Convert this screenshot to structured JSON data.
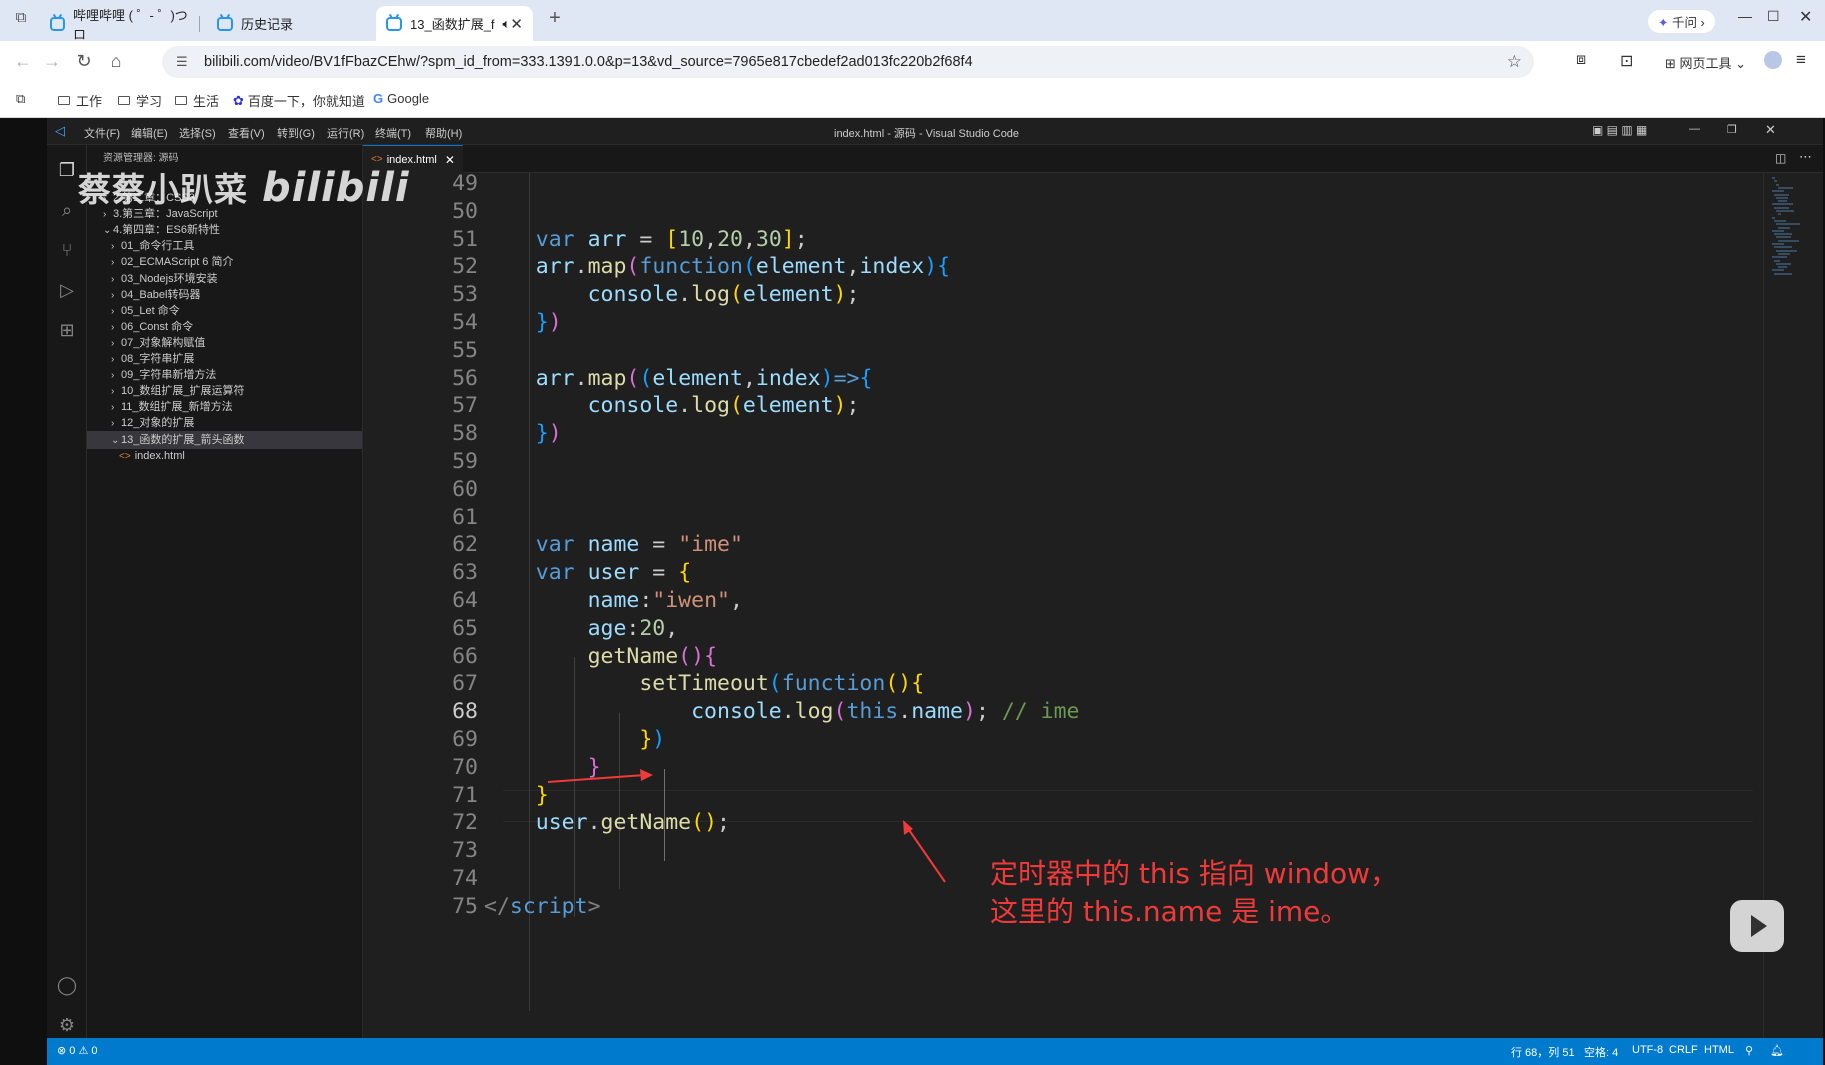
{
  "browser": {
    "tabs": [
      {
        "label": "哔哩哔哩 ( ゜- ゜)つロ"
      },
      {
        "label": "历史记录"
      },
      {
        "label": "13_函数扩展_f"
      }
    ],
    "new_tab": "+",
    "qianwen": "千问",
    "url": "bilibili.com/video/BV1fFbazCEhw/?spm_id_from=333.1391.0.0&p=13&vd_source=7965e817cbedef2ad013fc220b2f68f4",
    "tools_label": "网页工具",
    "bookmarks": [
      "工作",
      "学习",
      "生活",
      "百度一下，你就知道",
      "Google"
    ]
  },
  "vscode": {
    "menu": [
      "文件(F)",
      "编辑(E)",
      "选择(S)",
      "查看(V)",
      "转到(G)",
      "运行(R)",
      "终端(T)",
      "帮助(H)"
    ],
    "window_title": "index.html - 源码 - Visual Studio Code",
    "explorer_title": "资源管理器: 源码",
    "tree": [
      {
        "label": "2.第二章：CSS3",
        "indent": 1,
        "chev": "›"
      },
      {
        "label": "3.第三章：JavaScript",
        "indent": 1,
        "chev": "›"
      },
      {
        "label": "4.第四章：ES6新特性",
        "indent": 1,
        "chev": "⌄"
      },
      {
        "label": "01_命令行工具",
        "indent": 2,
        "chev": "›"
      },
      {
        "label": "02_ECMAScript 6 简介",
        "indent": 2,
        "chev": "›"
      },
      {
        "label": "03_Nodejs环境安装",
        "indent": 2,
        "chev": "›"
      },
      {
        "label": "04_Babel转码器",
        "indent": 2,
        "chev": "›"
      },
      {
        "label": "05_Let 命令",
        "indent": 2,
        "chev": "›"
      },
      {
        "label": "06_Const 命令",
        "indent": 2,
        "chev": "›"
      },
      {
        "label": "07_对象解构赋值",
        "indent": 2,
        "chev": "›"
      },
      {
        "label": "08_字符串扩展",
        "indent": 2,
        "chev": "›"
      },
      {
        "label": "09_字符串新增方法",
        "indent": 2,
        "chev": "›"
      },
      {
        "label": "10_数组扩展_扩展运算符",
        "indent": 2,
        "chev": "›"
      },
      {
        "label": "11_数组扩展_新增方法",
        "indent": 2,
        "chev": "›"
      },
      {
        "label": "12_对象的扩展",
        "indent": 2,
        "chev": "›"
      },
      {
        "label": "13_函数的扩展_箭头函数",
        "indent": 2,
        "chev": "⌄",
        "selected": true
      },
      {
        "label": "index.html",
        "indent": 3,
        "chev": "",
        "file": true
      }
    ],
    "editor_tab": "index.html",
    "status": {
      "errors": "⊗ 0 ⚠ 0",
      "position": "行 68，列 51",
      "spaces": "空格: 4",
      "encoding": "UTF-8",
      "eol": "CRLF",
      "language": "HTML"
    }
  },
  "code_lines": [
    {
      "n": "49",
      "html": ""
    },
    {
      "n": "50",
      "html": ""
    },
    {
      "n": "51",
      "html": "    <span class='kw'>var</span> <span class='var'>arr</span> = <span class='b1'>[</span><span class='num'>10</span>,<span class='num'>20</span>,<span class='num'>30</span><span class='b1'>]</span>;"
    },
    {
      "n": "52",
      "html": "    <span class='var'>arr</span>.<span class='fn'>map</span><span class='b2'>(</span><span class='kw'>function</span><span class='b3'>(</span><span class='var'>element</span>,<span class='var'>index</span><span class='b3'>){</span>"
    },
    {
      "n": "53",
      "html": "        <span class='var'>console</span>.<span class='fn'>log</span><span class='b1'>(</span><span class='var'>element</span><span class='b1'>)</span>;"
    },
    {
      "n": "54",
      "html": "    <span class='b3'>}</span><span class='b2'>)</span>"
    },
    {
      "n": "55",
      "html": ""
    },
    {
      "n": "56",
      "html": "    <span class='var'>arr</span>.<span class='fn'>map</span><span class='b2'>(</span><span class='b3'>(</span><span class='var'>element</span>,<span class='var'>index</span><span class='b3'>)</span><span class='kw'>=&gt;</span><span class='b3'>{</span>"
    },
    {
      "n": "57",
      "html": "        <span class='var'>console</span>.<span class='fn'>log</span><span class='b1'>(</span><span class='var'>element</span><span class='b1'>)</span>;"
    },
    {
      "n": "58",
      "html": "    <span class='b3'>}</span><span class='b2'>)</span>"
    },
    {
      "n": "59",
      "html": ""
    },
    {
      "n": "60",
      "html": ""
    },
    {
      "n": "61",
      "html": ""
    },
    {
      "n": "62",
      "html": "    <span class='kw'>var</span> <span class='var'>name</span> = <span class='str'>\"ime\"</span>"
    },
    {
      "n": "63",
      "html": "    <span class='kw'>var</span> <span class='var'>user</span> = <span class='b1'>{</span>"
    },
    {
      "n": "64",
      "html": "        <span class='var'>name</span>:<span class='str'>\"iwen\"</span>,"
    },
    {
      "n": "65",
      "html": "        <span class='var'>age</span>:<span class='num'>20</span>,"
    },
    {
      "n": "66",
      "html": "        <span class='fn'>getName</span><span class='b2'>()</span><span class='b2'>{</span>"
    },
    {
      "n": "67",
      "html": "            <span class='fn'>setTimeout</span><span class='b3'>(</span><span class='kw'>function</span><span class='b1'>()</span><span class='b1'>{</span>"
    },
    {
      "n": "68",
      "html": "                <span class='var'>console</span>.<span class='fn'>log</span><span class='b2'>(</span><span class='kw'>this</span>.<span class='var'>name</span><span class='b2'>)</span>; <span class='cm'>// ime</span>"
    },
    {
      "n": "69",
      "html": "            <span class='b1'>}</span><span class='b3'>)</span>"
    },
    {
      "n": "70",
      "html": "        <span class='b2'>}</span>"
    },
    {
      "n": "71",
      "html": "    <span class='b1'>}</span>"
    },
    {
      "n": "72",
      "html": "    <span class='var'>user</span>.<span class='fn'>getName</span><span class='b1'>()</span>;"
    },
    {
      "n": "73",
      "html": ""
    },
    {
      "n": "74",
      "html": ""
    },
    {
      "n": "75",
      "html": "<span class='tag'>&lt;/</span><span class='tagn'>script</span><span class='tag'>&gt;</span>"
    }
  ],
  "annotation": {
    "line1": "定时器中的 this 指向 window，",
    "line2": "这里的 this.name 是 ime。"
  },
  "watermark": {
    "text": "蔡蔡小趴菜",
    "brand": "bilibili"
  }
}
